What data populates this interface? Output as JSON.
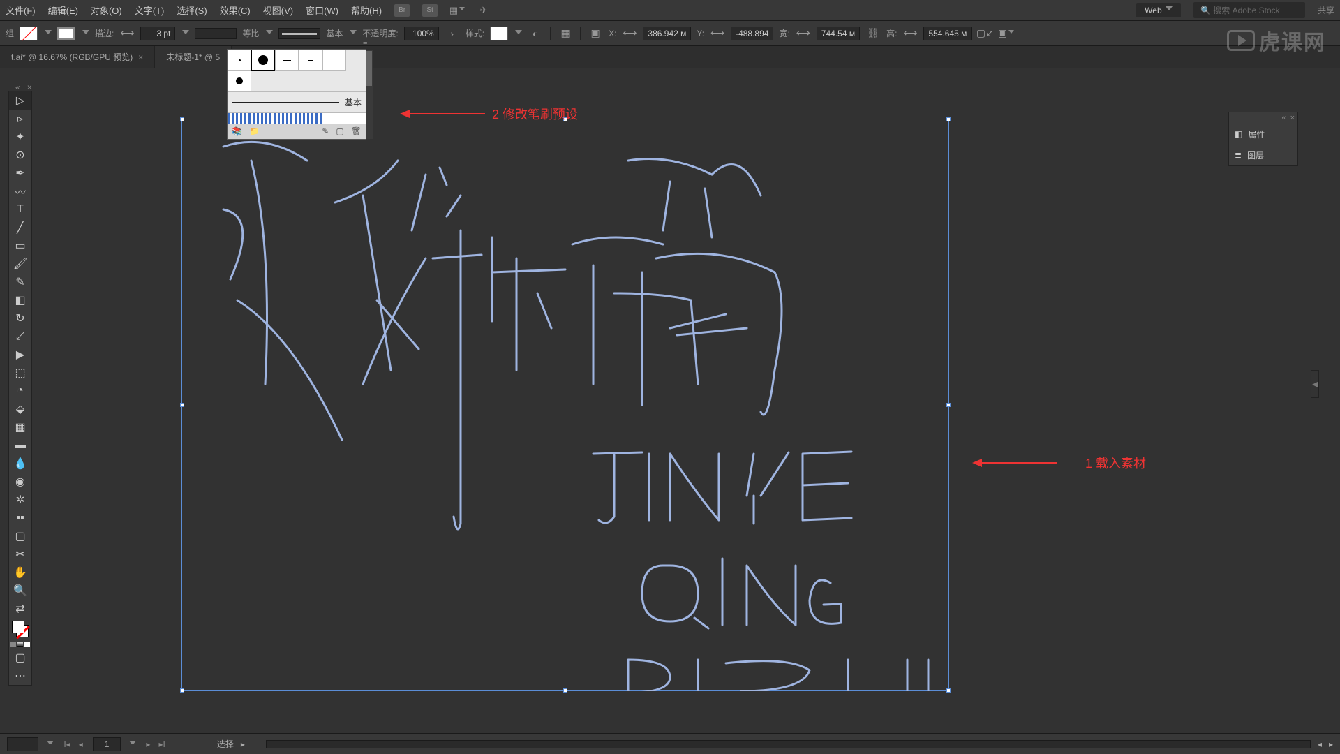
{
  "menubar": {
    "items": [
      "文件(F)",
      "编辑(E)",
      "对象(O)",
      "文字(T)",
      "选择(S)",
      "效果(C)",
      "视图(V)",
      "窗口(W)",
      "帮助(H)"
    ],
    "web_label": "Web",
    "search_placeholder": "搜索 Adobe Stock",
    "share_label": "共享"
  },
  "controlbar": {
    "stroke_label": "描边:",
    "stroke_weight": "3 pt",
    "profile_label": "等比",
    "brush_label": "基本",
    "opacity_label": "不透明度:",
    "opacity_value": "100%",
    "style_label": "样式:",
    "x_label": "X:",
    "x_value": "386.942 м",
    "y_label": "Y:",
    "y_value": "-488.894",
    "w_label": "宽:",
    "w_value": "744.54 м",
    "h_label": "高:",
    "h_value": "554.645 м"
  },
  "tabs": [
    {
      "label": "t.ai* @ 16.67% (RGB/GPU 预览)",
      "active": false
    },
    {
      "label": "未标题-1* @ 5",
      "active": true
    }
  ],
  "brush_popup": {
    "basic_label": "基本"
  },
  "annotations": {
    "a1": "1 载入素材",
    "a2": "2 修改笔刷预设"
  },
  "right_panel": {
    "props": "属性",
    "layers": "图层"
  },
  "status": {
    "artboard": "1",
    "tool": "选择"
  },
  "watermark": "虎课网",
  "canvas_text": {
    "line1": "JIN YE",
    "line2": "QING",
    "line3": "BIZUI"
  }
}
